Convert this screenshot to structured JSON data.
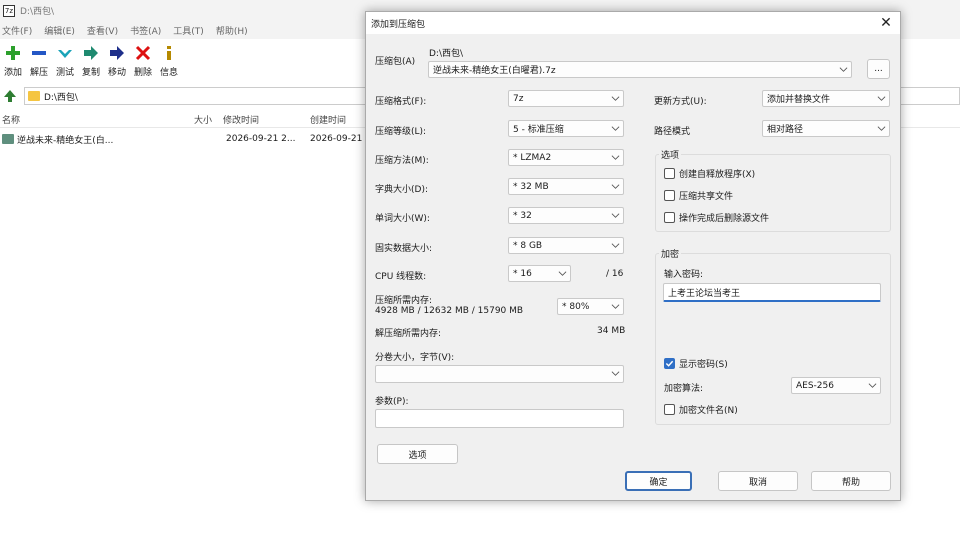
{
  "filemanager": {
    "title": "D:\\西包\\",
    "menu": [
      "文件(F)",
      "编辑(E)",
      "查看(V)",
      "书签(A)",
      "工具(T)",
      "帮助(H)"
    ],
    "toolbar": [
      "添加",
      "解压",
      "测试",
      "复制",
      "移动",
      "删除",
      "信息"
    ],
    "address": "D:\\西包\\",
    "headers": {
      "name": "名称",
      "size": "大小",
      "modified": "修改时间",
      "created": "创建时间"
    },
    "row": {
      "name": "逆战未来-精绝女王(白...",
      "modified": "2026-09-21 2...",
      "created": "2026-09-21"
    }
  },
  "dialog": {
    "title": "添加到压缩包",
    "close": "✕",
    "archive": {
      "label": "压缩包(A)",
      "path": "D:\\西包\\",
      "value": "逆战未来-精绝女王(白曜君).7z",
      "browse": "..."
    },
    "left": {
      "format": {
        "label": "压缩格式(F):",
        "value": "7z"
      },
      "level": {
        "label": "压缩等级(L):",
        "value": "5 - 标准压缩"
      },
      "method": {
        "label": "压缩方法(M):",
        "value": "* LZMA2"
      },
      "dict": {
        "label": "字典大小(D):",
        "value": "* 32 MB"
      },
      "word": {
        "label": "单词大小(W):",
        "value": "* 32"
      },
      "solid": {
        "label": "固实数据大小:",
        "value": "* 8 GB"
      },
      "cpu": {
        "label": "CPU 线程数:",
        "value": "* 16",
        "total": "/ 16"
      },
      "memory": {
        "label": "压缩所需内存:",
        "detail": "4928 MB / 12632 MB / 15790 MB",
        "value": "* 80%"
      },
      "decompmem": {
        "label": "解压缩所需内存:",
        "value": "34 MB"
      },
      "split": {
        "label": "分卷大小，字节(V):",
        "value": ""
      },
      "params": {
        "label": "参数(P):",
        "value": ""
      },
      "options_button": "选项"
    },
    "right": {
      "update": {
        "label": "更新方式(U):",
        "value": "添加并替换文件"
      },
      "pathmode": {
        "label": "路径模式",
        "value": "相对路径"
      },
      "options": {
        "title": "选项",
        "sfx": "创建自释放程序(X)",
        "shared": "压缩共享文件",
        "delete": "操作完成后删除源文件"
      },
      "encryption": {
        "title": "加密",
        "pwd_label": "输入密码:",
        "pwd_value": "上考王论坛当考王",
        "show_pwd": "显示密码(S)",
        "method_label": "加密算法:",
        "method_value": "AES-256",
        "encrypt_names": "加密文件名(N)"
      }
    },
    "buttons": {
      "ok": "确定",
      "cancel": "取消",
      "help": "帮助"
    }
  }
}
